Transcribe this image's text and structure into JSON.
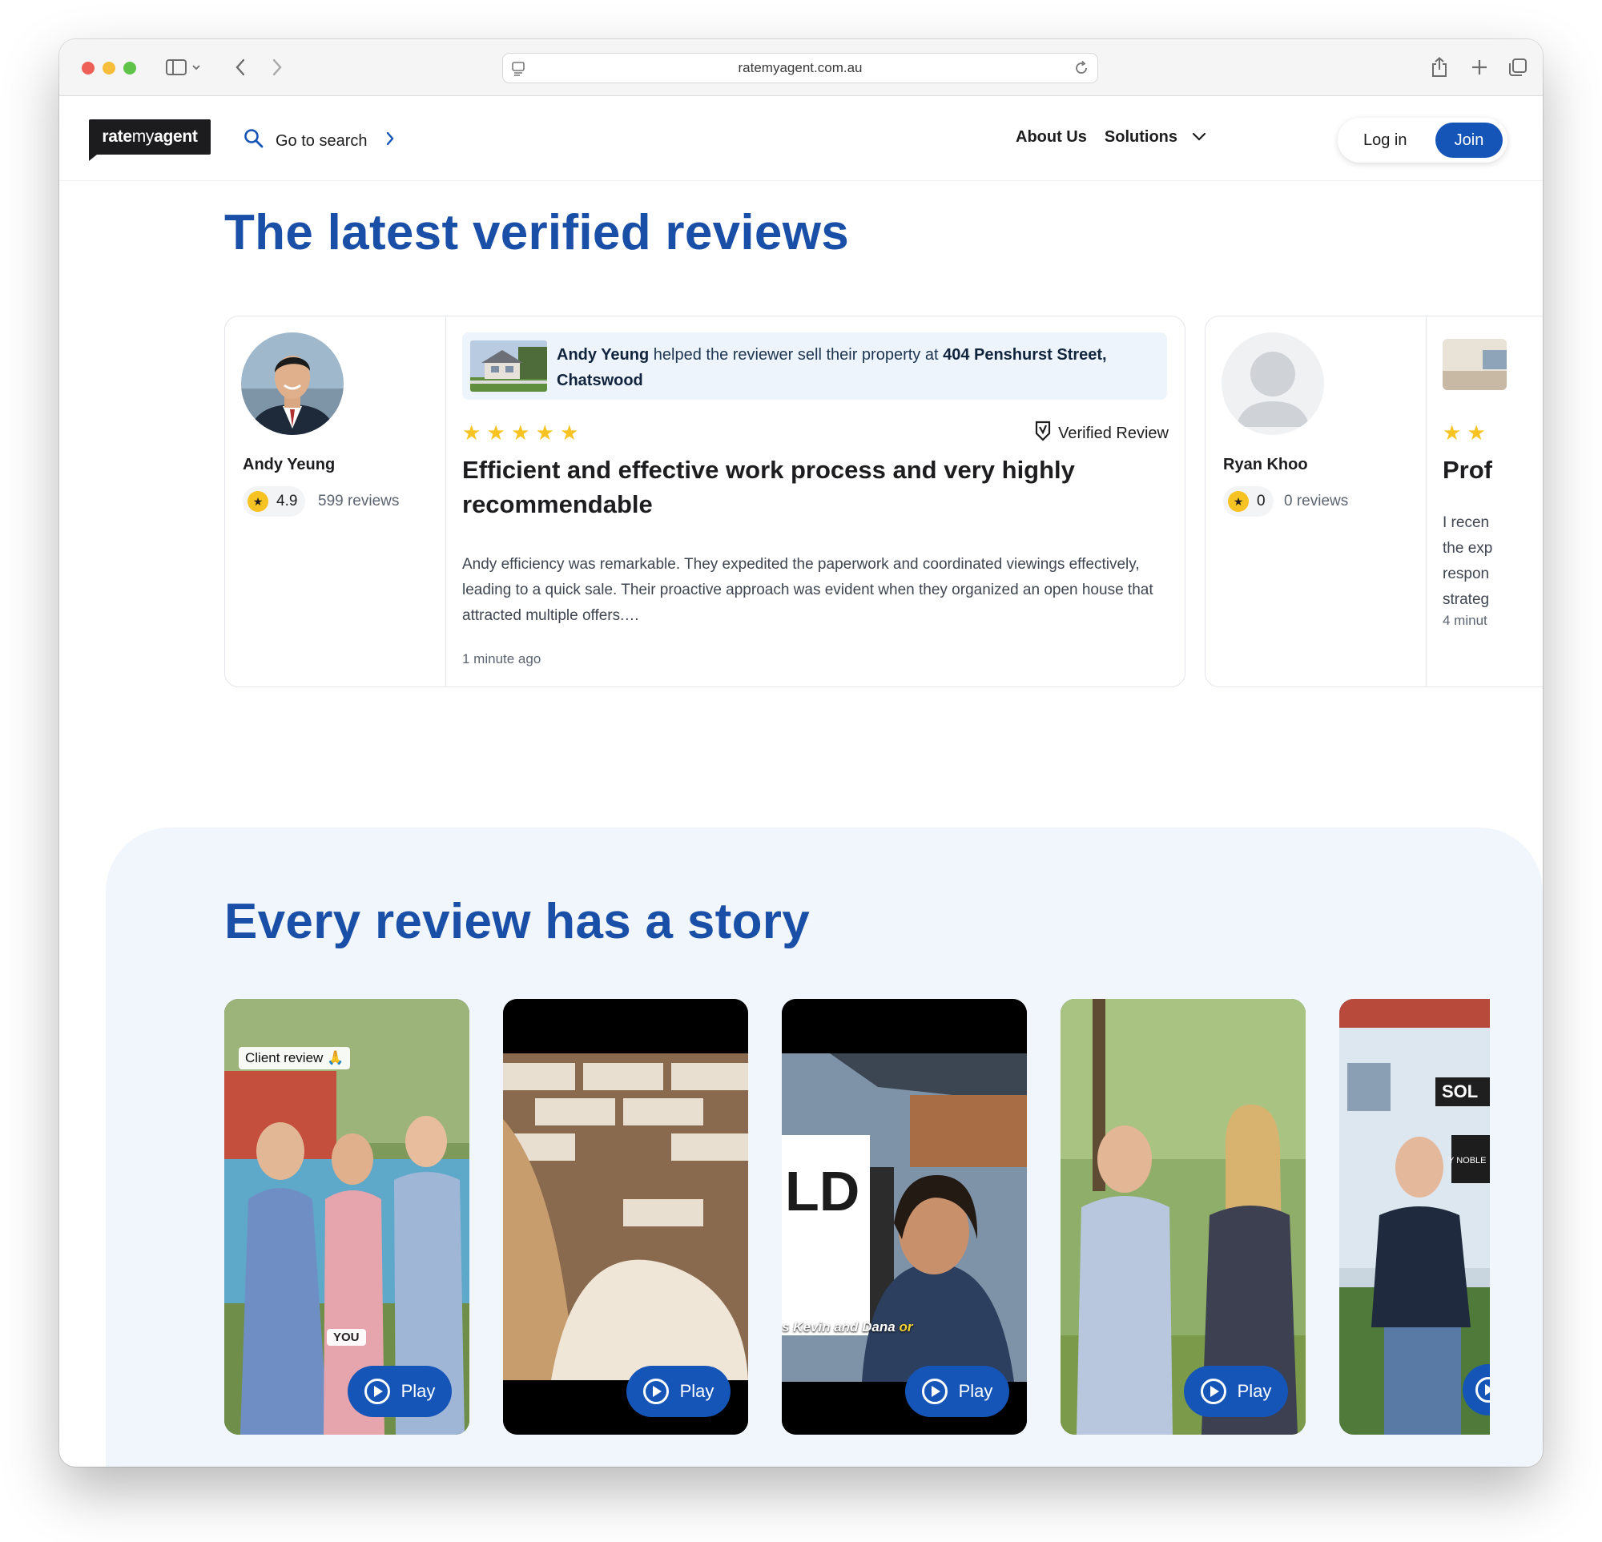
{
  "browser": {
    "url": "ratemyagent.com.au"
  },
  "header": {
    "logo_bold": "rate",
    "logo_light": "my",
    "logo_bold2": "agent",
    "search_label": "Go to search",
    "nav": {
      "about": "About Us",
      "solutions": "Solutions"
    },
    "login": "Log in",
    "join": "Join"
  },
  "reviews_section": {
    "title": "The latest verified reviews",
    "cards": [
      {
        "agent_name": "Andy Yeung",
        "rating": "4.9",
        "review_count": "599 reviews",
        "prop_agent": "Andy Yeung",
        "prop_middle": " helped the reviewer sell their property at ",
        "prop_address": "404 Penshurst Street, Chatswood",
        "stars": "★ ★ ★ ★ ★",
        "verified": "Verified Review",
        "review_title": "Efficient and effective work process and very highly recommendable",
        "review_body": "Andy efficiency was remarkable. They expedited the paperwork and coordinated viewings effectively, leading to a quick sale. Their proactive approach was evident when they organized an open house that attracted multiple offers.…",
        "time_ago": "1 minute ago"
      },
      {
        "agent_name": "Ryan Khoo",
        "rating": "0",
        "review_count": "0 reviews",
        "stars": "★ ★",
        "review_title": "Prof",
        "review_body_lines": [
          "I recen",
          "the exp",
          "respon",
          "strateg"
        ],
        "time_ago": "4 minut"
      }
    ]
  },
  "story_section": {
    "title": "Every review has a story",
    "play_label": "Play",
    "video1_caption": "Client review 🙏",
    "video1_tag": "YOU",
    "video3_subtitle_a": "s Kevin and Dana ",
    "video3_subtitle_b": "or",
    "video3_sign": "LD",
    "video5_sign": "SOL",
    "video5_board": "Y NOBLE"
  },
  "colors": {
    "brand_blue": "#1655b8",
    "title_blue": "#1a4fa8",
    "star_yellow": "#f7c323"
  }
}
